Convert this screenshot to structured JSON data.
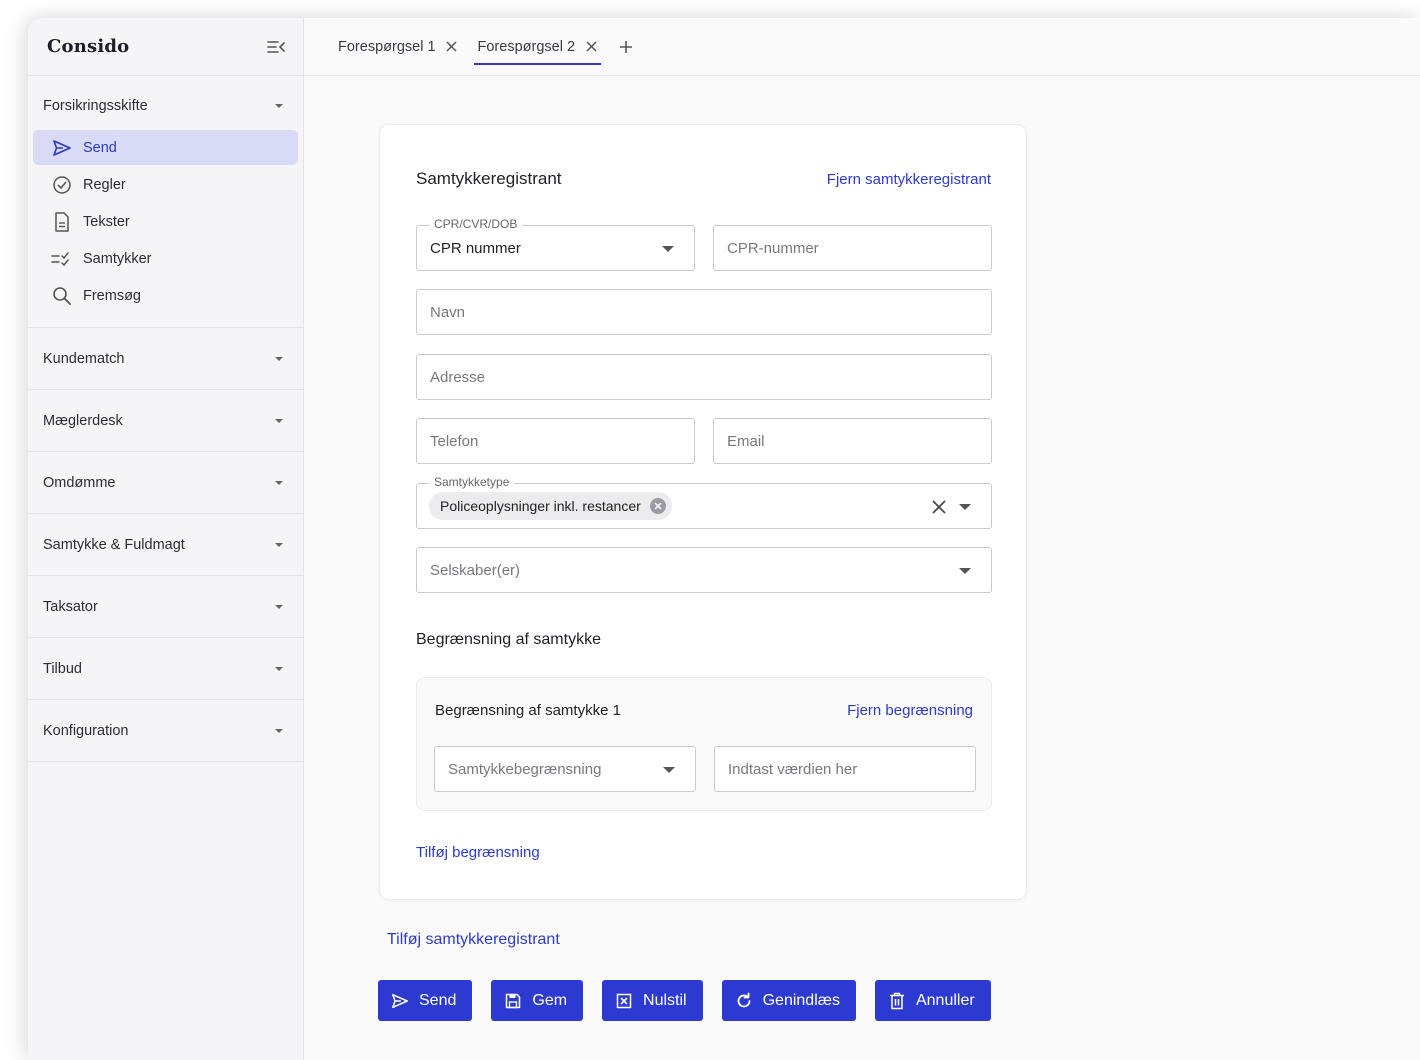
{
  "app": {
    "brand": "Consido"
  },
  "sidebar": {
    "groups": [
      {
        "label": "Forsikringsskifte",
        "expanded": true,
        "items": [
          {
            "label": "Send",
            "icon": "send-icon",
            "active": true
          },
          {
            "label": "Regler",
            "icon": "check-circle-icon"
          },
          {
            "label": "Tekster",
            "icon": "document-icon"
          },
          {
            "label": "Samtykker",
            "icon": "checklist-icon"
          },
          {
            "label": "Fremsøg",
            "icon": "search-icon"
          }
        ]
      },
      {
        "label": "Kundematch"
      },
      {
        "label": "Mæglerdesk"
      },
      {
        "label": "Omdømme"
      },
      {
        "label": "Samtykke & Fuldmagt"
      },
      {
        "label": "Taksator"
      },
      {
        "label": "Tilbud"
      },
      {
        "label": "Konfiguration"
      }
    ]
  },
  "tabs": [
    {
      "label": "Forespørgsel 1",
      "active": false
    },
    {
      "label": "Forespørgsel 2",
      "active": true
    }
  ],
  "form": {
    "title": "Samtykkeregistrant",
    "remove_registrant": "Fjern samtykkeregistrant",
    "id_type": {
      "label": "CPR/CVR/DOB",
      "value": "CPR nummer"
    },
    "cpr_placeholder": "CPR-nummer",
    "name_placeholder": "Navn",
    "address_placeholder": "Adresse",
    "phone_placeholder": "Telefon",
    "email_placeholder": "Email",
    "consent_type": {
      "label": "Samtykketype",
      "chip": "Policeoplysninger inkl. restancer"
    },
    "companies_placeholder": "Selskaber(er)",
    "limit_section_title": "Begrænsning af samtykke",
    "limit": {
      "title": "Begrænsning af samtykke 1",
      "remove": "Fjern begrænsning",
      "select_placeholder": "Samtykkebegrænsning",
      "value_placeholder": "Indtast værdien her"
    },
    "add_limit": "Tilføj begrænsning"
  },
  "add_registrant": "Tilføj samtykkeregistrant",
  "actions": {
    "send": "Send",
    "save": "Gem",
    "reset": "Nulstil",
    "reload": "Genindlæs",
    "cancel": "Annuller"
  },
  "colors": {
    "primary": "#2d3ad1",
    "active_bg": "#d9dbf6"
  }
}
